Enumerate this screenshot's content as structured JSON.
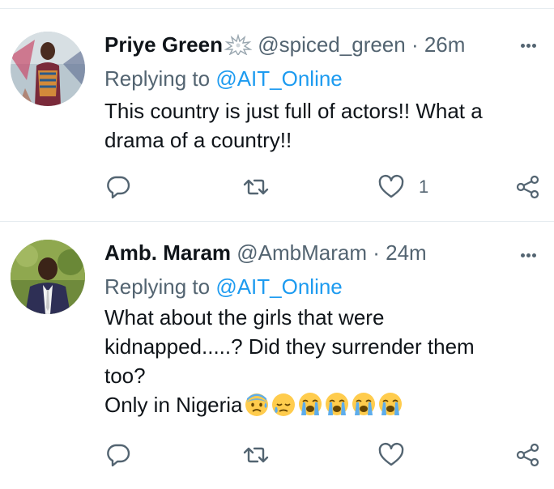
{
  "tweets": [
    {
      "name": "Priye Green",
      "handle": "@spiced_green",
      "time": "26m",
      "replying_label": "Replying to",
      "replying_to": "@AIT_Online",
      "lines": [
        "This country is just full of actors!! What a",
        "drama of a country!!"
      ],
      "like_count": "1",
      "badge_icon": "explosion-badge-icon"
    },
    {
      "name": "Amb. Maram",
      "handle": "@AmbMaram",
      "time": "24m",
      "replying_label": "Replying to",
      "replying_to": "@AIT_Online",
      "lines": [
        "What about the girls that were",
        "kidnapped.....? Did they surrender them",
        "too?",
        "Only in Nigeria"
      ],
      "like_count": "",
      "emojis": [
        "anxious-sweat-face-emoji",
        "sad-relieved-face-emoji",
        "loudly-crying-face-emoji",
        "loudly-crying-face-emoji",
        "loudly-crying-face-emoji",
        "loudly-crying-face-emoji"
      ]
    }
  ],
  "separator": " · ",
  "colors": {
    "link": "#1d9bf0",
    "muted": "#536471",
    "text": "#0f1419",
    "divider": "#e6ecf0"
  }
}
